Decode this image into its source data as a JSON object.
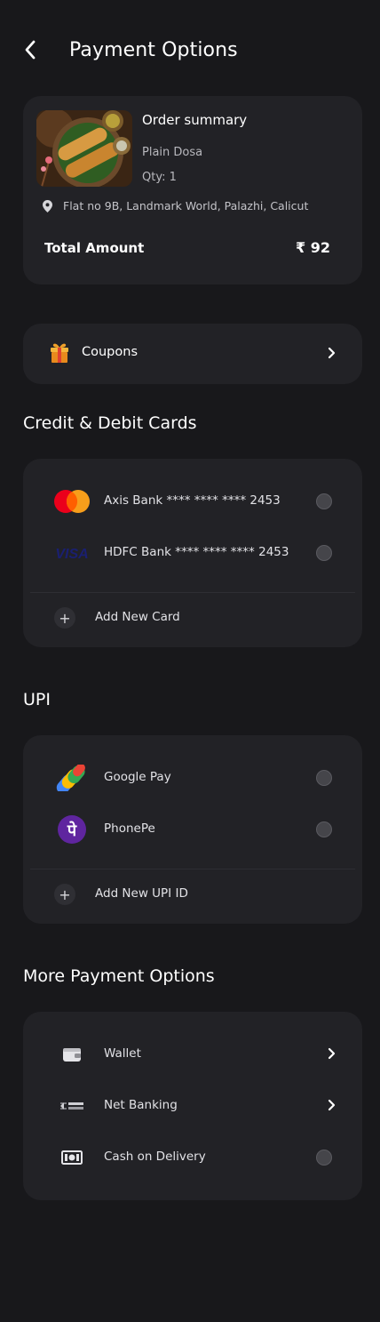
{
  "header": {
    "title": "Payment Options"
  },
  "order": {
    "title": "Order summary",
    "item": "Plain Dosa",
    "qty": "Qty: 1",
    "location": "Flat no 9B, Landmark World, Palazhi, Calicut",
    "total_label": "Total Amount",
    "total_value": "₹ 92"
  },
  "coupons": {
    "label": "Coupons"
  },
  "cards_section": {
    "title": "Credit & Debit Cards",
    "items": [
      {
        "label": "Axis Bank **** **** **** 2453",
        "icon": "mastercard-icon"
      },
      {
        "label": "HDFC Bank **** **** **** 2453",
        "icon": "visa-icon"
      }
    ],
    "add_label": "Add New Card"
  },
  "upi_section": {
    "title": "UPI",
    "items": [
      {
        "label": "Google Pay",
        "icon": "google-pay-icon"
      },
      {
        "label": "PhonePe",
        "icon": "phonepe-icon"
      }
    ],
    "add_label": "Add New UPI ID"
  },
  "more_section": {
    "title": "More Payment Options",
    "items": [
      {
        "label": "Wallet",
        "icon": "wallet-icon",
        "control": "chevron"
      },
      {
        "label": "Net Banking",
        "icon": "bank-transfer-icon",
        "control": "chevron"
      },
      {
        "label": "Cash on Delivery",
        "icon": "cash-icon",
        "control": "radio"
      }
    ]
  },
  "colors": {
    "background": "#18181b",
    "card": "#222226",
    "radio": "#45454a",
    "phonepe": "#5f259f",
    "mastercard_red": "#eb001b",
    "mastercard_orange": "#f79e1b",
    "visa": "#1a1f71"
  }
}
